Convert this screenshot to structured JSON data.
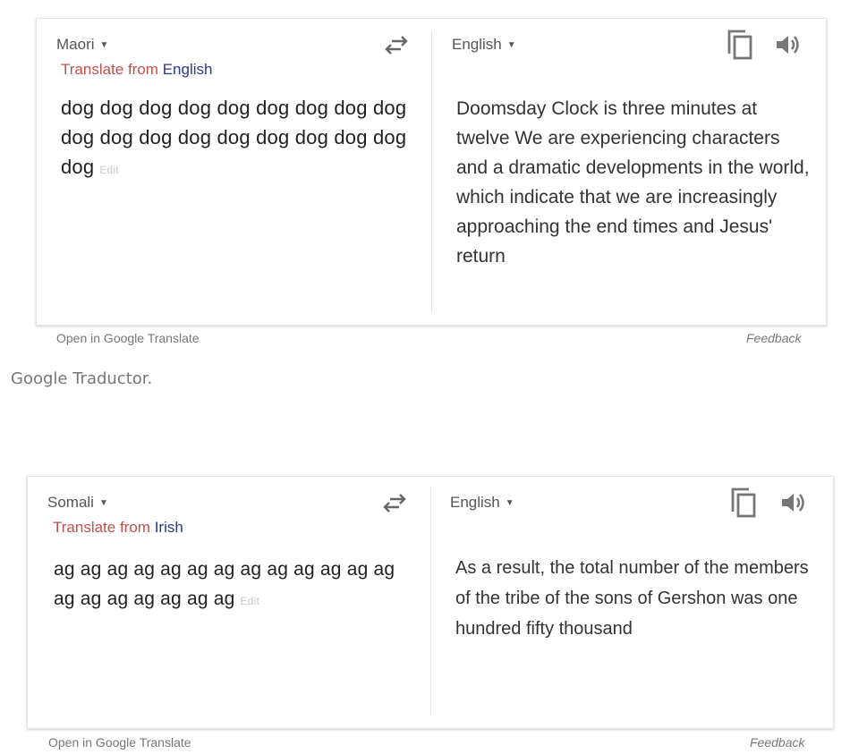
{
  "panel1": {
    "source_language": "Maori",
    "detected_prefix": "Translate from",
    "detected_language": "English",
    "source_text": "dog dog dog dog dog dog dog dog dog dog dog dog dog dog dog dog dog dog dog",
    "edit_label": "Edit",
    "target_language": "English",
    "translation": "Doomsday Clock is three minutes at twelve We are experiencing characters and a dramatic developments in the world, which indicate that we are increasingly approaching the end times and Jesus' return",
    "open_link": "Open in Google Translate",
    "feedback": "Feedback"
  },
  "caption": "Google Traductor.",
  "panel2": {
    "source_language": "Somali",
    "detected_prefix": "Translate from",
    "detected_language": "Irish",
    "source_text": "ag ag ag ag ag ag ag ag ag ag ag ag ag ag ag ag ag ag ag ag",
    "edit_label": "Edit",
    "target_language": "English",
    "translation": "As a result, the total number of the members of the tribe of the sons of Gershon was one hundred fifty thousand",
    "open_link": "Open in Google Translate",
    "feedback": "Feedback"
  },
  "icons": {
    "swap": "swap-languages-icon",
    "copy": "copy-icon",
    "listen": "speaker-icon",
    "dropdown": "caret-down-icon"
  }
}
